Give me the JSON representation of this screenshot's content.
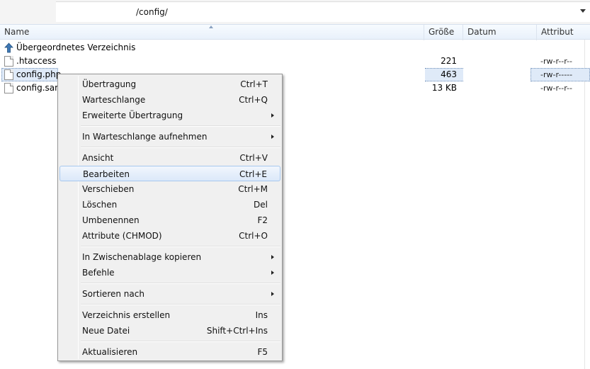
{
  "pathbar": {
    "path": "/config/"
  },
  "columns": {
    "name": "Name",
    "size": "Größe",
    "date": "Datum",
    "attr": "Attribut"
  },
  "files": [
    {
      "name": "Übergeordnetes Verzeichnis",
      "size": "",
      "attr": "",
      "icon": "parent-folder-icon"
    },
    {
      "name": ".htaccess",
      "size": "221",
      "attr": "-rw-r--r--",
      "icon": "file-icon"
    },
    {
      "name": "config.php",
      "size": "463",
      "attr": "-rw-r-----",
      "icon": "file-icon",
      "selected": true
    },
    {
      "name": "config.sam",
      "size": "13 KB",
      "attr": "-rw-r--r--",
      "icon": "file-icon"
    }
  ],
  "menu": {
    "items": [
      {
        "label": "Übertragung",
        "shortcut": "Ctrl+T"
      },
      {
        "label": "Warteschlange",
        "shortcut": "Ctrl+Q"
      },
      {
        "label": "Erweiterte Übertragung",
        "shortcut": "",
        "submenu": true
      },
      {
        "label": "In Warteschlange aufnehmen",
        "shortcut": "",
        "submenu": true
      },
      {
        "label": "Ansicht",
        "shortcut": "Ctrl+V"
      },
      {
        "label": "Bearbeiten",
        "shortcut": "Ctrl+E",
        "highlighted": true
      },
      {
        "label": "Verschieben",
        "shortcut": "Ctrl+M"
      },
      {
        "label": "Löschen",
        "shortcut": "Del"
      },
      {
        "label": "Umbenennen",
        "shortcut": "F2"
      },
      {
        "label": "Attribute (CHMOD)",
        "shortcut": "Ctrl+O"
      },
      {
        "label": "In Zwischenablage kopieren",
        "shortcut": "",
        "submenu": true
      },
      {
        "label": "Befehle",
        "shortcut": "",
        "submenu": true
      },
      {
        "label": "Sortieren nach",
        "shortcut": "",
        "submenu": true
      },
      {
        "label": "Verzeichnis erstellen",
        "shortcut": "Ins"
      },
      {
        "label": "Neue Datei",
        "shortcut": "Shift+Ctrl+Ins"
      },
      {
        "label": "Aktualisieren",
        "shortcut": "F5"
      }
    ]
  }
}
